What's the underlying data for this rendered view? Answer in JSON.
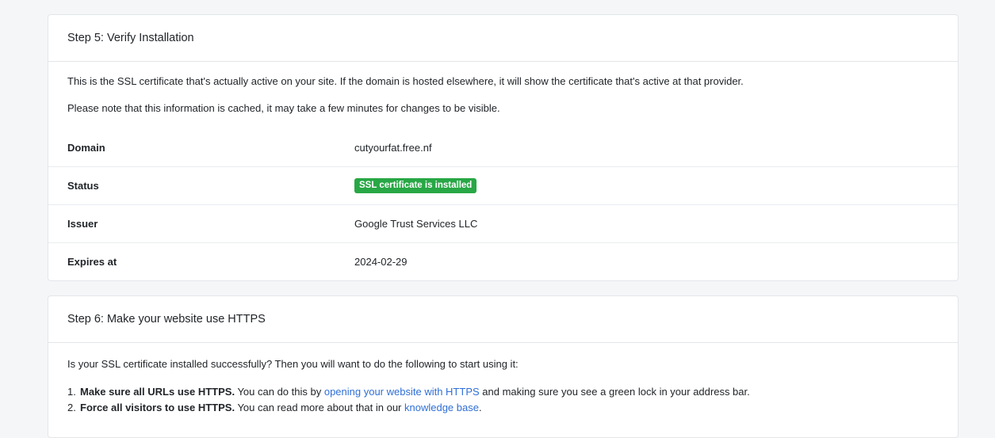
{
  "step5": {
    "title": "Step 5: Verify Installation",
    "intro": "This is the SSL certificate that's actually active on your site. If the domain is hosted elsewhere, it will show the certificate that's active at that provider.",
    "cache_note": "Please note that this information is cached, it may take a few minutes for changes to be visible.",
    "rows": [
      {
        "label": "Domain",
        "value": "cutyourfat.free.nf"
      },
      {
        "label": "Status",
        "value": "SSL certificate is installed"
      },
      {
        "label": "Issuer",
        "value": "Google Trust Services LLC"
      },
      {
        "label": "Expires at",
        "value": "2024-02-29"
      }
    ],
    "status_color": "#28a745"
  },
  "step6": {
    "title": "Step 6: Make your website use HTTPS",
    "intro": "Is your SSL certificate installed successfully? Then you will want to do the following to start using it:",
    "items": [
      {
        "number": "1.",
        "bold": "Make sure all URLs use HTTPS.",
        "text_before": " You can do this by ",
        "link": "opening your website with HTTPS",
        "text_after": " and making sure you see a green lock in your address bar."
      },
      {
        "number": "2.",
        "bold": "Force all visitors to use HTTPS.",
        "text_before": " You can read more about that in our ",
        "link": "knowledge base",
        "text_after": "."
      }
    ],
    "link_color": "#2f6fd6"
  }
}
